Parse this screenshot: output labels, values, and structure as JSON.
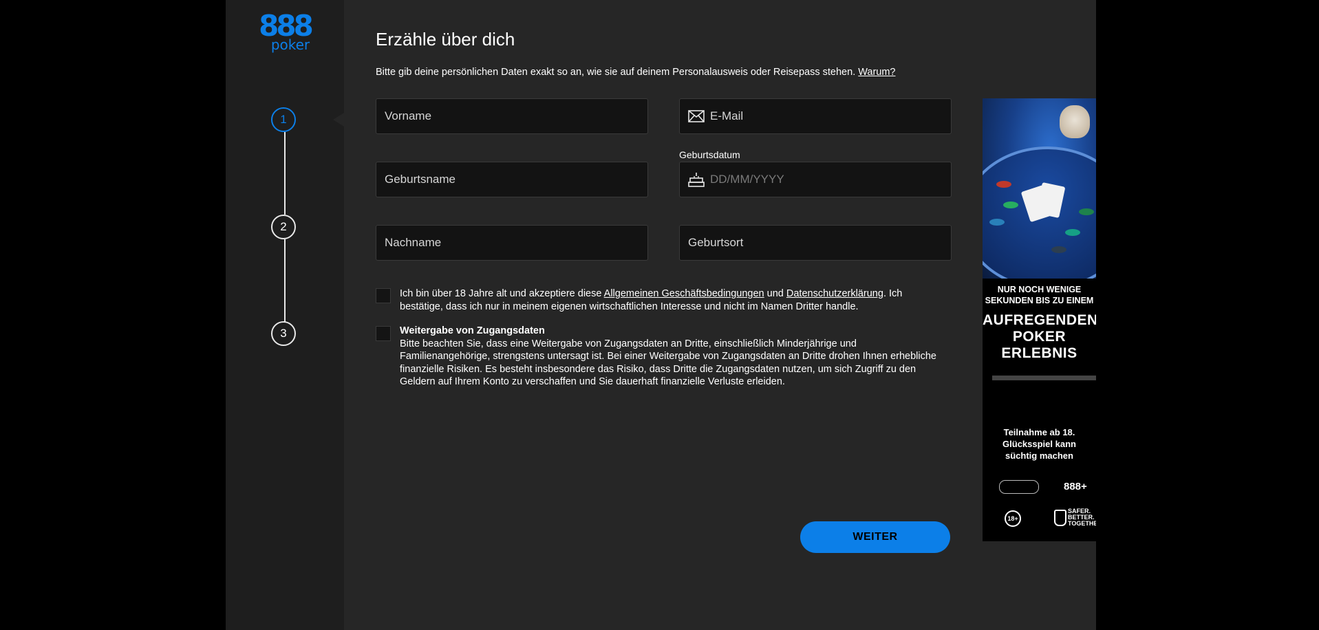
{
  "brand": {
    "logo_top": "888",
    "logo_bottom": "poker"
  },
  "steps": [
    {
      "number": "1",
      "active": true
    },
    {
      "number": "2",
      "active": false
    },
    {
      "number": "3",
      "active": false
    }
  ],
  "form": {
    "title": "Erzähle über dich",
    "intro": "Bitte gib deine persönlichen Daten exakt so an, wie sie auf deinem Personalausweis oder Reisepass stehen.",
    "intro_link": "Warum?",
    "fields": {
      "vorname": {
        "placeholder": "Vorname",
        "value": ""
      },
      "email": {
        "placeholder": "E-Mail",
        "value": "",
        "icon": "envelope-icon"
      },
      "geburtsname": {
        "placeholder": "Geburtsname",
        "value": ""
      },
      "geburtsdatum": {
        "label": "Geburtsdatum",
        "placeholder": "DD/MM/YYYY",
        "value": "",
        "icon": "birthday-cake-icon"
      },
      "nachname": {
        "placeholder": "Nachname",
        "value": ""
      },
      "geburtsort": {
        "placeholder": "Geburtsort",
        "value": ""
      }
    },
    "terms": {
      "text_1": "Ich bin über 18 Jahre alt und akzeptiere diese ",
      "link_agb": "Allgemeinen Geschäftsbedingungen",
      "text_2": " und ",
      "link_privacy": "Datenschutzerklärung",
      "text_3": ". Ich bestätige, dass ich nur in meinem eigenen wirtschaftlichen Interesse und nicht im Namen Dritter handle.",
      "checked": false
    },
    "sharing": {
      "title": "Weitergabe von Zugangsdaten",
      "text": "Bitte beachten Sie, dass eine Weitergabe von Zugangsdaten an Dritte, einschließlich Minderjährige und Familienangehörige, strengstens untersagt ist. Bei einer Weitergabe von Zugangsdaten an Dritte drohen Ihnen erhebliche finanzielle Risiken. Es besteht insbesondere das Risiko, dass Dritte die Zugangsdaten nutzen, um sich Zugriff zu den Geldern auf Ihrem Konto zu verschaffen und Sie dauerhaft finanzielle Verluste erleiden.",
      "checked": false
    },
    "submit_label": "WEITER"
  },
  "ad": {
    "line1": "NUR NOCH WENIGE",
    "line2": "SEKUNDEN BIS ZU EINEM",
    "headline_1": "AUFREGENDEN",
    "headline_2": "POKER",
    "headline_3": "ERLEBNIS",
    "info_1": "Teilnahme ab 18.",
    "info_2": "Glücksspiel kann",
    "info_3": "süchtig machen",
    "badge_888": "888+",
    "badge_18": "18+",
    "badge_safer_1": "SAFER.",
    "badge_safer_2": "BETTER.",
    "badge_safer_3": "TOGETHER."
  },
  "colors": {
    "accent": "#0c7fe8",
    "panel": "#262626",
    "sidebar": "#1e1e1e",
    "input_bg": "#131313"
  }
}
